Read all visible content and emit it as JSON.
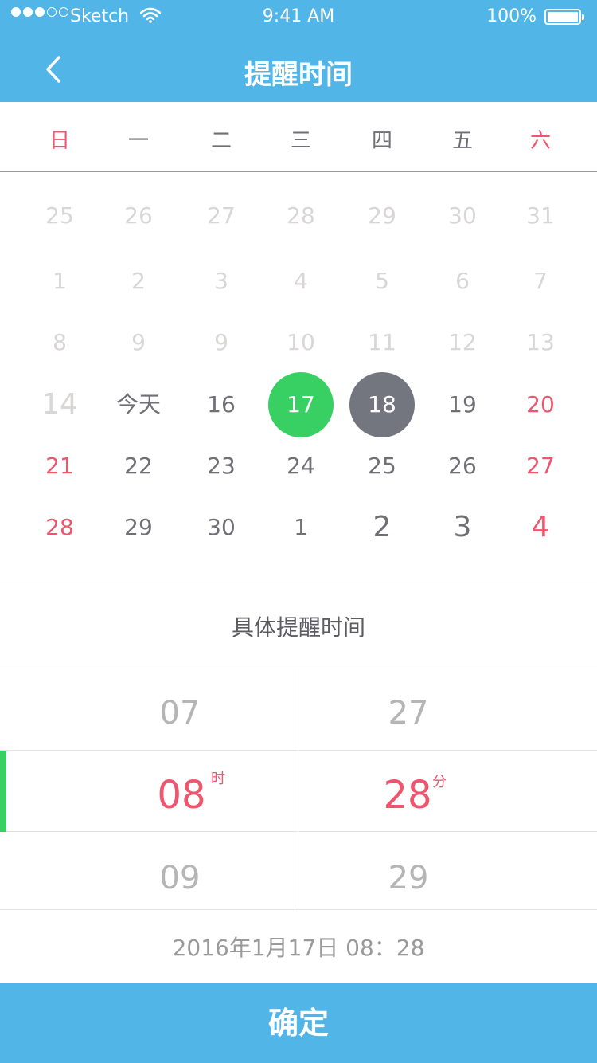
{
  "status_bar": {
    "carrier": "Sketch",
    "time": "9:41 AM",
    "battery": "100%",
    "battery_level": 1.0
  },
  "nav": {
    "title": "提醒时间",
    "back_icon": "chevron-left-icon"
  },
  "weekdays": [
    "日",
    "一",
    "二",
    "三",
    "四",
    "五",
    "六"
  ],
  "calendar": {
    "rows": [
      [
        {
          "label": "25",
          "style": "faded"
        },
        {
          "label": "26",
          "style": "faded"
        },
        {
          "label": "27",
          "style": "faded"
        },
        {
          "label": "28",
          "style": "faded"
        },
        {
          "label": "29",
          "style": "faded"
        },
        {
          "label": "30",
          "style": "faded"
        },
        {
          "label": "31",
          "style": "faded"
        }
      ],
      [
        {
          "label": "1",
          "style": "faded"
        },
        {
          "label": "2",
          "style": "faded"
        },
        {
          "label": "3",
          "style": "faded"
        },
        {
          "label": "4",
          "style": "faded"
        },
        {
          "label": "5",
          "style": "faded"
        },
        {
          "label": "6",
          "style": "faded"
        },
        {
          "label": "7",
          "style": "faded"
        }
      ],
      [
        {
          "label": "8",
          "style": "faded"
        },
        {
          "label": "9",
          "style": "faded"
        },
        {
          "label": "9",
          "style": "faded"
        },
        {
          "label": "10",
          "style": "faded"
        },
        {
          "label": "11",
          "style": "faded"
        },
        {
          "label": "12",
          "style": "faded"
        },
        {
          "label": "13",
          "style": "faded"
        }
      ],
      [
        {
          "label": "14",
          "style": "faded-big"
        },
        {
          "label": "今天",
          "style": "today"
        },
        {
          "label": "16",
          "style": "normal"
        },
        {
          "label": "17",
          "style": "selected-green"
        },
        {
          "label": "18",
          "style": "selected-gray"
        },
        {
          "label": "19",
          "style": "normal"
        },
        {
          "label": "20",
          "style": "red"
        }
      ],
      [
        {
          "label": "21",
          "style": "red"
        },
        {
          "label": "22",
          "style": "normal"
        },
        {
          "label": "23",
          "style": "normal"
        },
        {
          "label": "24",
          "style": "normal"
        },
        {
          "label": "25",
          "style": "normal"
        },
        {
          "label": "26",
          "style": "normal"
        },
        {
          "label": "27",
          "style": "red"
        }
      ],
      [
        {
          "label": "28",
          "style": "red"
        },
        {
          "label": "29",
          "style": "normal"
        },
        {
          "label": "30",
          "style": "normal"
        },
        {
          "label": "1",
          "style": "normal"
        },
        {
          "label": "2",
          "style": "big"
        },
        {
          "label": "3",
          "style": "big"
        },
        {
          "label": "4",
          "style": "red-big"
        }
      ]
    ]
  },
  "section_title": "具体提醒时间",
  "time_picker": {
    "hours": {
      "prev": "07",
      "current": "08",
      "next": "09",
      "unit": "时"
    },
    "minutes": {
      "prev": "27",
      "current": "28",
      "next": "29",
      "unit": "分"
    }
  },
  "summary": "2016年1月17日   08：28",
  "confirm_label": "确定",
  "colors": {
    "accent": "#52b5e7",
    "weekend_red": "#ee566e",
    "selected_green": "#39d063",
    "selected_gray": "#73767f"
  }
}
